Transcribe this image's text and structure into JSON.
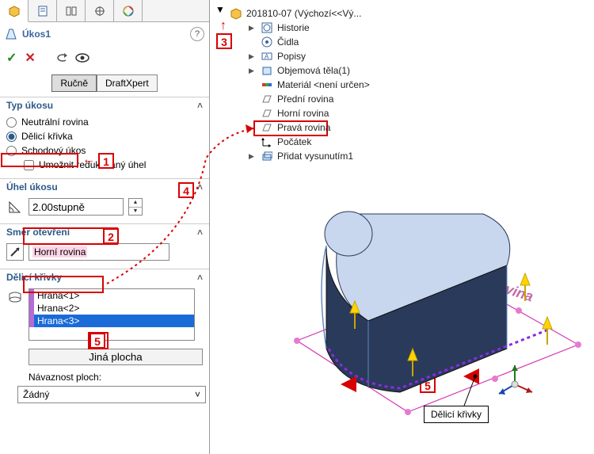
{
  "annotation_numbers": {
    "n1": "1",
    "n2": "2",
    "n3": "3",
    "n4": "4",
    "n5": "5",
    "n5b": "5"
  },
  "annotation_arrows": {
    "left1": "←",
    "up3": "↑"
  },
  "feature": {
    "name": "Úkos1",
    "ok": "✓",
    "cancel": "✕"
  },
  "modebar": {
    "manual": "Ručně",
    "expert": "DraftXpert"
  },
  "section_type": {
    "header": "Typ úkosu",
    "opt_neutral": "Neutrální rovina",
    "opt_parting": "Dělicí křivka",
    "opt_step": "Schodový úkos",
    "chk_reduced": "Umožnit redukovaný úhel"
  },
  "section_angle": {
    "header": "Úhel úkosu",
    "value": "2.00stupně"
  },
  "section_direction": {
    "header": "Směr otevření",
    "value": "Horní rovina"
  },
  "section_curves": {
    "header": "Dělicí křivky",
    "items": [
      "Hrana<1>",
      "Hrana<2>",
      "Hrana<3>"
    ],
    "other_face_btn": "Jiná plocha",
    "continuity_label": "Návaznost ploch:",
    "continuity_value": "Žádný"
  },
  "tree": {
    "root": "201810-07 (Výchozí<<Vý...",
    "history": "Historie",
    "sensors": "Čidla",
    "annotations": "Popisy",
    "bodies": "Objemová těla(1)",
    "material": "Materiál <není určen>",
    "front": "Přední rovina",
    "top": "Horní rovina",
    "right": "Pravá rovina",
    "origin": "Počátek",
    "extrude": "Přidat vysunutím1"
  },
  "viewport": {
    "callout": "Dělicí křivky",
    "plane_label": "Horní rovina"
  }
}
